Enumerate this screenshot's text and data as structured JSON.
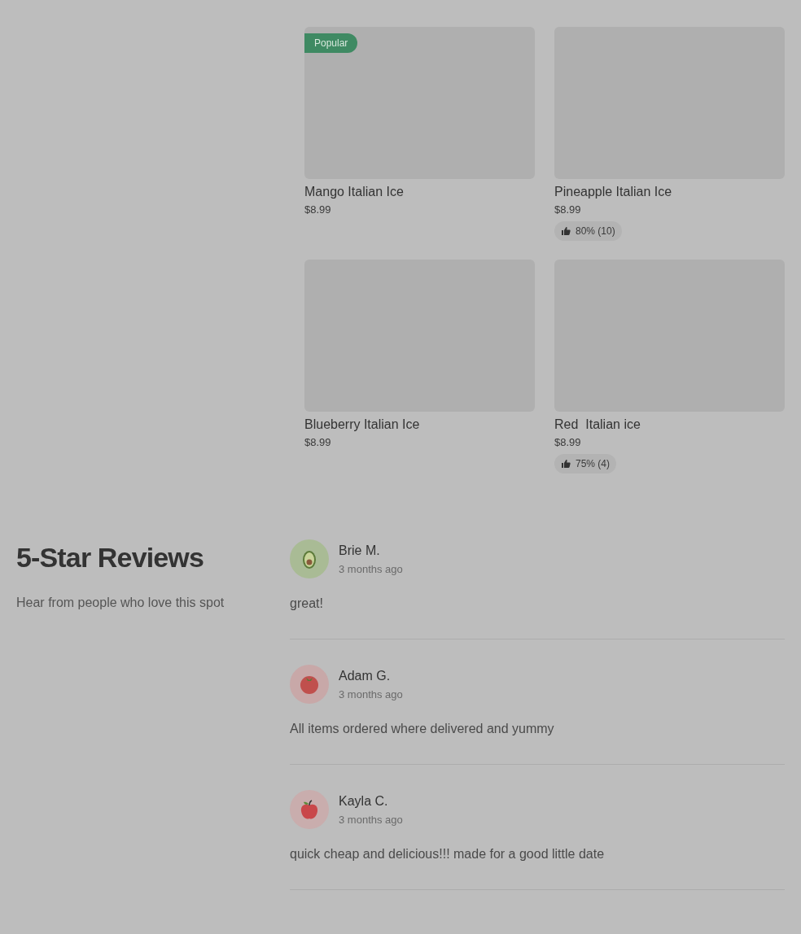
{
  "menu_items": [
    {
      "name": "Mango Italian Ice",
      "price": "$8.99",
      "popular": true
    },
    {
      "name": "Pineapple Italian Ice",
      "price": "$8.99",
      "popular": false,
      "rating": "80% (10)"
    },
    {
      "name": "Blueberry Italian Ice",
      "price": "$8.99",
      "popular": false
    },
    {
      "name": "Red  Italian ice",
      "price": "$8.99",
      "popular": false,
      "rating": "75% (4)"
    }
  ],
  "popular_label": "Popular",
  "reviews_section": {
    "title": "5-Star Reviews",
    "subtitle": "Hear from people who love this spot",
    "reviews": [
      {
        "name": "Brie M.",
        "time": "3 months ago",
        "text": "great!",
        "kind": "avocado"
      },
      {
        "name": "Adam G.",
        "time": "3 months ago",
        "text": "All items ordered where delivered and yummy",
        "kind": "tomato"
      },
      {
        "name": "Kayla C.",
        "time": "3 months ago",
        "text": "quick cheap and delicious!!! made for a good little date",
        "kind": "apple"
      }
    ]
  }
}
